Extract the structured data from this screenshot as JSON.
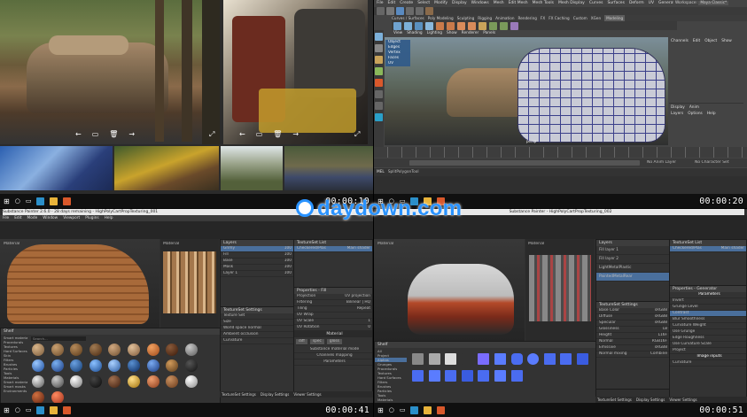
{
  "watermark": {
    "text": "daydown.com"
  },
  "timestamps": [
    "00:00:10",
    "00:00:20",
    "00:00:41",
    "00:00:51"
  ],
  "q1": {
    "viewer_icons": [
      "back-icon",
      "gallery-icon",
      "delete-icon",
      "forward-icon",
      "fullscreen-icon"
    ]
  },
  "q2": {
    "menu": [
      "File",
      "Edit",
      "Create",
      "Select",
      "Modify",
      "Display",
      "Windows",
      "Mesh",
      "Edit Mesh",
      "Mesh Tools",
      "Mesh Display",
      "Curves",
      "Surfaces",
      "Deform",
      "UV",
      "Generate",
      "Cache",
      "Help"
    ],
    "workspace_label": "Workspace:",
    "workspace_value": "Maya Classic*",
    "shelf_tabs": [
      "Curves / Surfaces",
      "Poly Modeling",
      "Sculpting",
      "Rigging",
      "Animation",
      "Rendering",
      "FX",
      "FX Caching",
      "Custom",
      "XGen",
      "Modeling"
    ],
    "viewport_menu": [
      "View",
      "Shading",
      "Lighting",
      "Show",
      "Renderer",
      "Panels"
    ],
    "select_panel": [
      "Object",
      "Edges",
      "Vertex",
      "Faces",
      "UV"
    ],
    "channel_box_tabs": [
      "Channels",
      "Edit",
      "Object",
      "Show"
    ],
    "display_tabs": [
      "Display",
      "Anim"
    ],
    "layers_menu": [
      "Layers",
      "Options",
      "Help"
    ],
    "persp_label": "persp",
    "mel_label": "MEL",
    "mel_text": "SplitPolygonTool",
    "anim_layer": "No Anim Layer",
    "char_set": "No Character Set"
  },
  "q3": {
    "title": "Substance Painter 2.6.0 - 28 days remaining - HighPolyCartPropTexturing_001",
    "menu": [
      "File",
      "Edit",
      "Mode",
      "Window",
      "Viewport",
      "Plugins",
      "Help"
    ],
    "viewport_label": "Material",
    "uv_label": "Material",
    "layers_title": "Layers",
    "layer_items": [
      "Grimy",
      "Fill",
      "Base",
      "Mask",
      "Layer 1"
    ],
    "layer_values": [
      "100",
      "100",
      "100",
      "100",
      "100"
    ],
    "texset_title": "TextureSet List",
    "texset_item": "Checkered/Plas",
    "texset_value": "Main shader",
    "texset_settings_title": "TextureSet Settings",
    "texset_settings_rows": [
      "Texture Set",
      "Size",
      "World space normal",
      "Ambient occlusion",
      "Curvature"
    ],
    "properties_title": "Properties - Fill",
    "properties_rows": [
      "Projection",
      "Filtering",
      "Tiling",
      "UV Wrap",
      "UV Scale",
      "UV Rotation"
    ],
    "properties_values": [
      "UV projection",
      "Bilinear | HQ",
      "Repeat",
      "",
      "1",
      "0"
    ],
    "material_title": "Material",
    "material_modes": [
      "diff",
      "spec",
      "gloss"
    ],
    "substance_title": "Substance material mode",
    "channels_title": "Channels mapping",
    "params_title": "Parameters",
    "shelf_title": "Shelf",
    "shelf_cats": [
      "Smart materials",
      "Procedurals",
      "Textures",
      "Hard Surfaces",
      "Skin",
      "Filters",
      "Brushes",
      "Particles",
      "Tools",
      "Materials",
      "Smart materials",
      "Smart masks",
      "Environments"
    ],
    "search_placeholder": "Search...",
    "material_names": [
      "Artificial Leather",
      "Leather Big Grain",
      "Leather Bag",
      "Leather Fine",
      "Leather Medium",
      "Leather Calf",
      "Leather Orange",
      "Leather",
      "Cloth",
      "Plastic Glossy",
      "Plastic Matte",
      "Plastic Rough",
      "Plastic Soft",
      "Plastic Diamond",
      "Plastic Grain",
      "Plastic Gloss",
      "Bronze Armor",
      "Soft Rubber",
      "Steel",
      "Iron",
      "Aluminium",
      "Rubber Tyre",
      "Worn Leather",
      "Gold",
      "Copper",
      "Wood",
      "Silver",
      "Rust",
      "Glass"
    ],
    "bottom_tabs": [
      "TextureSet Settings",
      "Display Settings",
      "Viewer Settings"
    ]
  },
  "q4": {
    "title": "Substance Painter - HighPolyCartPropTexturing_002",
    "viewport_label": "Material",
    "uv_label": "Material",
    "layers_title": "Layers",
    "layer_items": [
      "Fill layer 1",
      "Fill layer 2",
      "LightMetalPlastic",
      "PaintedMetalRear"
    ],
    "texset_title": "TextureSet List",
    "texset_item": "Checkered/Plas",
    "texset_value": "Main shader",
    "texset_settings_title": "TextureSet Settings",
    "texset_rows": [
      "Base Color",
      "Diffuse",
      "Specular",
      "Glossiness",
      "Height",
      "Normal",
      "Emissive",
      "Normal mixing"
    ],
    "texset_values": [
      "sRGB8",
      "sRGB8",
      "sRGB8",
      "L8",
      "L16F",
      "RGB16F",
      "sRGB8",
      "Combine"
    ],
    "properties_title": "Properties - Generator",
    "params_title": "Parameters",
    "param_rows": [
      "Invert",
      "Grunge Level",
      "Contrast",
      "Blur Smoothness",
      "Curvature Weight",
      "Use Grunge",
      "Edge Roughness",
      "Use Curvature Scale",
      "Project"
    ],
    "image_inputs_title": "Image inputs",
    "curvature_label": "Curvature",
    "shelf_title": "Shelf",
    "shelf_cats": [
      "All",
      "Project",
      "Alphas",
      "Grunges",
      "Procedurals",
      "Textures",
      "Hard Surfaces",
      "Filters",
      "Brushes",
      "Particles",
      "Tools",
      "Materials"
    ],
    "alpha_names": [
      "Grunge Map 1",
      "Grunge Map 2",
      "Grunge Map 3",
      "Dirt",
      "Beveled Star",
      "Beveled Star",
      "Capsule",
      "Circle",
      "Cylinder 01",
      "Cylinder 02"
    ],
    "bottom_tabs": [
      "TextureSet Settings",
      "Display Settings",
      "Viewer Settings"
    ]
  },
  "colors": {
    "watermark": "#2a93ff",
    "maya_ui": "#444444",
    "sp_ui": "#333333",
    "selection": "#4a6f9c",
    "accent_orange": "#d9582b"
  }
}
